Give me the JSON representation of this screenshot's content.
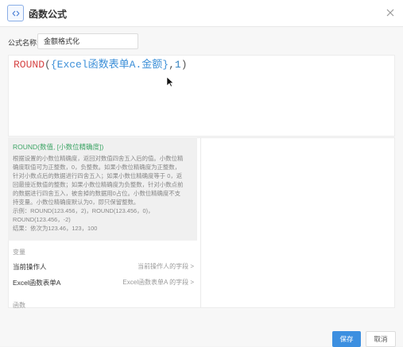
{
  "dialog": {
    "title": "函数公式",
    "icon": "function-icon",
    "close_icon": "close-icon"
  },
  "form": {
    "name_label": "公式名称:",
    "name_value": "金额格式化"
  },
  "editor": {
    "fn_name": "ROUND",
    "open": "(",
    "field_open": "{",
    "field_name": "Excel函数表单A.金额",
    "field_close": "}",
    "comma": ",",
    "arg": "1",
    "close": ")"
  },
  "help": {
    "signature": "ROUND(数值, [小数位精确度])",
    "lines": [
      "根据设置的小数位精确度，返回对数值四舍五入后的值。小数位精",
      "确度取值可为正整数，0，负整数。如果小数位精确度为正整数，",
      "针对小数点后的数据进行四舍五入；如果小数位精确度等于 0，返",
      "回最接近数值的整数；如果小数位精确度为负整数，针对小数点前",
      "的数据进行四舍五入，被舍掉的数据用0占位。小数位精确度不支",
      "持变量。小数位精确度默认为0，即只保留整数。",
      "示例：ROUND(123.456，2)，ROUND(123.456，0)，",
      "ROUND(123.456，-2)",
      "结果：依次为123.46，123，100"
    ]
  },
  "variables": {
    "section_label": "变量",
    "items": [
      {
        "name": "当前操作人",
        "desc": "当前操作人的字段 >"
      },
      {
        "name": "Excel函数表单A",
        "desc": "Excel函数表单A 的字段 >"
      }
    ]
  },
  "functions": {
    "section_label": "函数"
  },
  "footer": {
    "save_label": "保存",
    "cancel_label": "取消",
    "save_color": "#3c8fe0"
  }
}
